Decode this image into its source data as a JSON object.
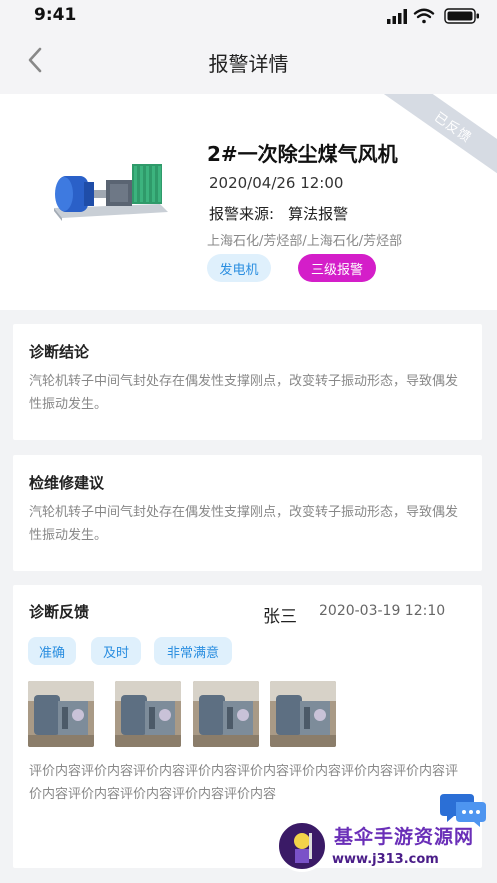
{
  "status_bar": {
    "time": "9:41"
  },
  "nav": {
    "title": "报警详情"
  },
  "alarm": {
    "status_ribbon": "已反馈",
    "device_name": "2#一次除尘煤气风机",
    "time": "2020/04/26 12:00",
    "source_label": "报警来源:",
    "source_value": "算法报警",
    "location": "上海石化/芳烃部/上海石化/芳烃部",
    "device_type_tag": "发电机",
    "level_tag": "三级报警",
    "level_color": "#d41ec9"
  },
  "diagnosis": {
    "title": "诊断结论",
    "text": "汽轮机转子中间气封处存在偶发性支撑刚点，改变转子振动形态，导致偶发性振动发生。"
  },
  "maintenance": {
    "title": "检维修建议",
    "text": "汽轮机转子中间气封处存在偶发性支撑刚点，改变转子振动形态，导致偶发性振动发生。"
  },
  "feedback": {
    "title": "诊断反馈",
    "user": "张三",
    "time": "2020-03-19 12:10",
    "tags": [
      "准确",
      "及时",
      "非常满意"
    ],
    "comment": "评价内容评价内容评价内容评价内容评价内容评价内容评价内容评价内容评价内容评价内容评价内容评价内容评价内容"
  },
  "watermark": {
    "title": "基伞手游资源网",
    "url": "www.j313.com"
  },
  "colors": {
    "accent_blue": "#2a8ee0",
    "tag_bg": "#dff0fc",
    "ribbon": "#d6dbe3"
  }
}
